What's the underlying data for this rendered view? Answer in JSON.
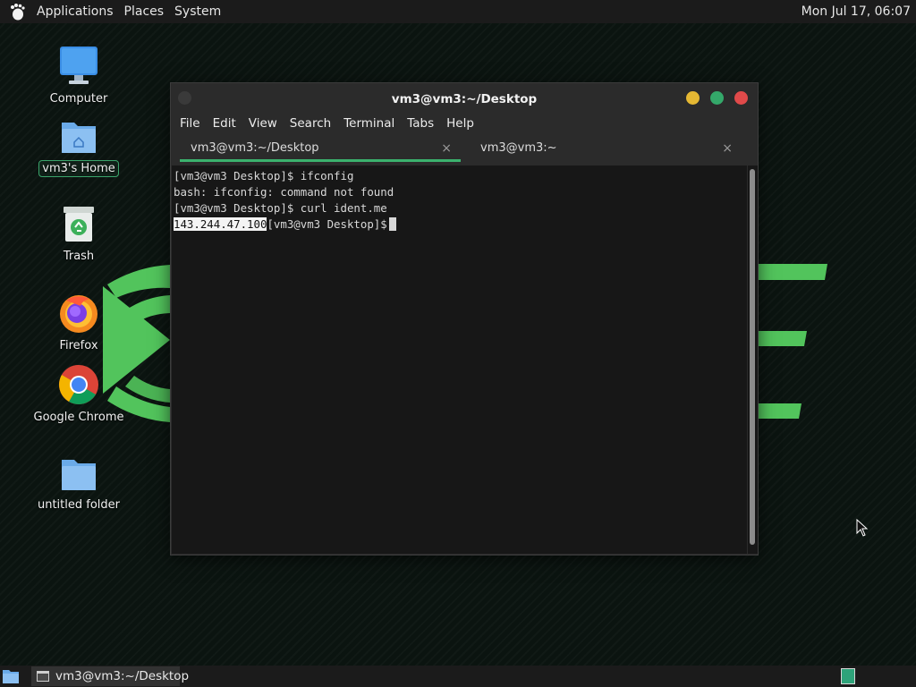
{
  "top_panel": {
    "menus": [
      "Applications",
      "Places",
      "System"
    ],
    "clock": "Mon Jul 17, 06:07"
  },
  "desktop_icons": [
    {
      "label": "Computer",
      "icon": "computer-icon"
    },
    {
      "label": "vm3's Home",
      "icon": "home-folder-icon",
      "selected": true
    },
    {
      "label": "Trash",
      "icon": "trash-icon"
    },
    {
      "label": "Firefox",
      "icon": "firefox-icon"
    },
    {
      "label": "Google Chrome",
      "icon": "chrome-icon"
    },
    {
      "label": "untitled folder",
      "icon": "folder-icon"
    }
  ],
  "terminal": {
    "title": "vm3@vm3:~/Desktop",
    "menu": [
      "File",
      "Edit",
      "View",
      "Search",
      "Terminal",
      "Tabs",
      "Help"
    ],
    "tabs": [
      {
        "label": "vm3@vm3:~/Desktop",
        "active": true
      },
      {
        "label": "vm3@vm3:~",
        "active": false
      }
    ],
    "tab_close": "×",
    "lines": [
      "[vm3@vm3 Desktop]$ ifconfig",
      "bash: ifconfig: command not found",
      "[vm3@vm3 Desktop]$ curl ident.me"
    ],
    "last_line_selected": "143.244.47.100",
    "last_line_prompt": "[vm3@vm3 Desktop]$"
  },
  "taskbar": {
    "window_label": "vm3@vm3:~/Desktop"
  },
  "colors": {
    "accent_green": "#3bb26e",
    "logo_green": "#4cc35a",
    "panel_bg": "#1b1b1b",
    "terminal_bg": "#171717"
  }
}
